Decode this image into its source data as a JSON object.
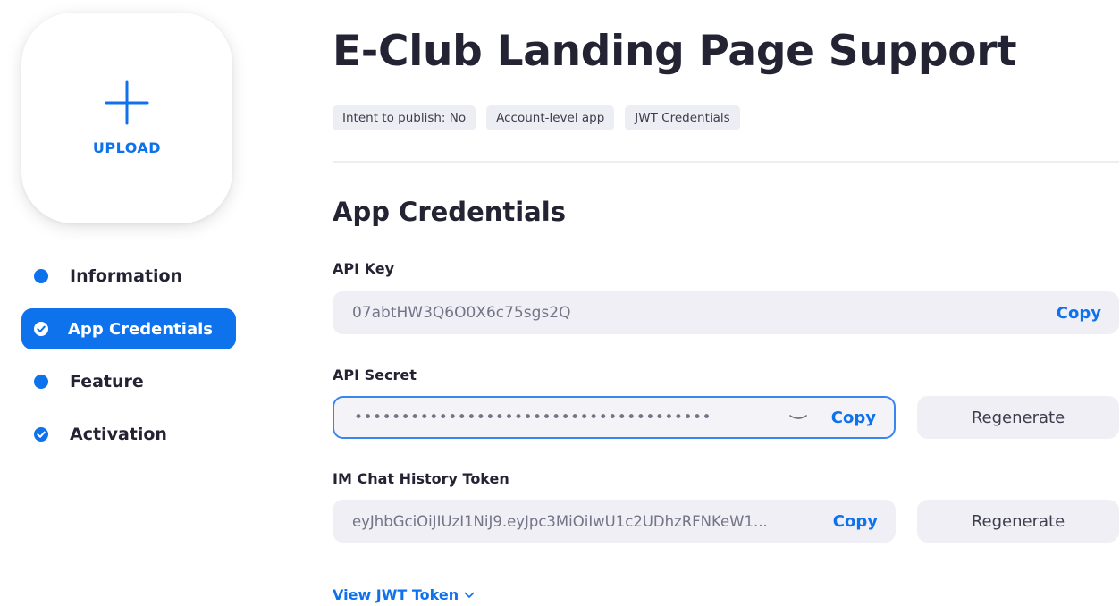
{
  "sidebar": {
    "upload_label": "UPLOAD",
    "items": [
      {
        "label": "Information",
        "state": "incomplete"
      },
      {
        "label": "App Credentials",
        "state": "active"
      },
      {
        "label": "Feature",
        "state": "incomplete"
      },
      {
        "label": "Activation",
        "state": "complete"
      }
    ]
  },
  "header": {
    "title": "E-Club Landing Page Support",
    "tags": [
      "Intent to publish: No",
      "Account-level app",
      "JWT Credentials"
    ]
  },
  "credentials": {
    "section_title": "App Credentials",
    "api_key": {
      "label": "API Key",
      "value": "07abtHW3Q6O0X6c75sgs2Q",
      "copy_label": "Copy"
    },
    "api_secret": {
      "label": "API Secret",
      "value": "••••••••••••••••••••••••••••••••••••••",
      "copy_label": "Copy",
      "regenerate_label": "Regenerate",
      "eye_icon": "eye-closed-icon"
    },
    "im_token": {
      "label": "IM Chat History Token",
      "value": "eyJhbGciOiJIUzI1NiJ9.eyJpc3MiOiIwU1c2UDhzRFNKeW1...",
      "copy_label": "Copy",
      "regenerate_label": "Regenerate"
    },
    "view_jwt_label": "View JWT Token"
  },
  "colors": {
    "accent": "#0e72ed",
    "text": "#232333",
    "field_bg": "#efeff5"
  }
}
